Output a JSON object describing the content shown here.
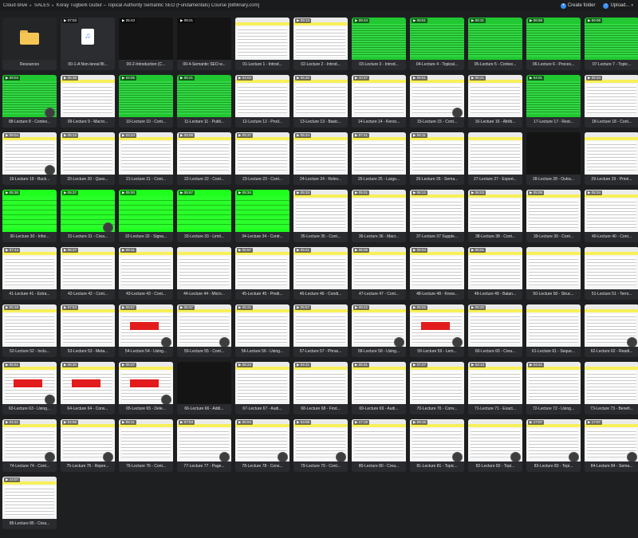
{
  "breadcrumb": {
    "items": [
      "Cloud drive",
      "SALES",
      "Koray Tugberk Gubur – Topical Authority Semantic SEO (Fundamentals) Course [bitfilinary.com]"
    ]
  },
  "actions": {
    "create_folder": "Create folder",
    "upload": "Upload..."
  },
  "tiles": [
    {
      "label": "Resources",
      "kind": "folder",
      "dur": ""
    },
    {
      "label": "00-1-A Non-Isreal Bl...",
      "kind": "audio",
      "dur": "07:03"
    },
    {
      "label": "00-2-Introduction (C...",
      "kind": "dark",
      "dur": "25:43"
    },
    {
      "label": "00-4-Semantic SEO w...",
      "kind": "dark",
      "dur": "08:21"
    },
    {
      "label": "01-Lecture 1 - Introd...",
      "kind": "doc",
      "dur": ""
    },
    {
      "label": "02-Lecture 2 - Introd...",
      "kind": "doc",
      "dur": "09:13"
    },
    {
      "label": "03-Lecture 3 - Introd...",
      "kind": "green",
      "dur": "08:43"
    },
    {
      "label": "04-Lecture 4 - Topical...",
      "kind": "green",
      "dur": "08:51"
    },
    {
      "label": "05-Lecture 5 - Contex...",
      "kind": "green",
      "dur": "05:31"
    },
    {
      "label": "06-Lecture 6 - Proces...",
      "kind": "green",
      "dur": "06:55"
    },
    {
      "label": "07-Lecture 7 - Topic...",
      "kind": "green",
      "dur": "06:06"
    },
    {
      "label": "08-Lecture 8 - Contex...",
      "kind": "green",
      "dur": "09:04",
      "avatar": true
    },
    {
      "label": "09-Lecture 9 - Macro...",
      "kind": "doc",
      "dur": "05:38"
    },
    {
      "label": "10-Lecture 10 - Cont...",
      "kind": "green",
      "dur": "04:06"
    },
    {
      "label": "11-Lecture 11 - Publi...",
      "kind": "green",
      "dur": "06:21"
    },
    {
      "label": "12-Lecture 12 - Prod...",
      "kind": "doc",
      "dur": "04:04"
    },
    {
      "label": "13-Lecture 13 - Basic...",
      "kind": "doc",
      "dur": "06:20"
    },
    {
      "label": "14-Lecture 14 - Kerso...",
      "kind": "doc",
      "dur": "10:37"
    },
    {
      "label": "15-Lecture 15 - Cont...",
      "kind": "doc",
      "dur": "06:51",
      "avatar": true
    },
    {
      "label": "16-Lecture 16 - Attrib...",
      "kind": "doc",
      "dur": "05:21"
    },
    {
      "label": "17-Lecture 17 - Rest...",
      "kind": "green",
      "dur": "04:01"
    },
    {
      "label": "18-Lecture 18 - Cont...",
      "kind": "doc",
      "dur": "05:34"
    },
    {
      "label": "19-Lecture 19 - Buck...",
      "kind": "doc",
      "dur": "09:04",
      "avatar": true
    },
    {
      "label": "20-Lecture 20 - Ques...",
      "kind": "doc",
      "dur": "05:13"
    },
    {
      "label": "21-Lecture 21 - Cont...",
      "kind": "doc",
      "dur": "04:24"
    },
    {
      "label": "22-Lecture 22 - Cont...",
      "kind": "doc",
      "dur": "09:08"
    },
    {
      "label": "23-Lecture 23 - Cont...",
      "kind": "doc",
      "dur": "05:37"
    },
    {
      "label": "24-Lecture 24 - Relev...",
      "kind": "doc",
      "dur": "05:24"
    },
    {
      "label": "25-Lecture 25 - Largo...",
      "kind": "doc",
      "dur": "07:41"
    },
    {
      "label": "26-Lecture 26 - Sema...",
      "kind": "doc",
      "dur": "06:11"
    },
    {
      "label": "27-Lecture 27 - Expert...",
      "kind": "doc",
      "dur": ""
    },
    {
      "label": "28-Lecture 28 - Outra...",
      "kind": "dark",
      "dur": ""
    },
    {
      "label": "29-Lecture 29 - Priori...",
      "kind": "doc",
      "dur": ""
    },
    {
      "label": "30-Lecture 30 - Infor...",
      "kind": "bright",
      "dur": "05:30"
    },
    {
      "label": "31-Lecture 31 - Crea...",
      "kind": "bright",
      "dur": "05:37",
      "avatar": true
    },
    {
      "label": "32-Lecture 32 - Signa...",
      "kind": "bright",
      "dur": "05:00"
    },
    {
      "label": "33-Lecture 33 - Limit...",
      "kind": "bright",
      "dur": "05:57"
    },
    {
      "label": "34-Lecture 34 - Contr...",
      "kind": "bright",
      "dur": "05:34"
    },
    {
      "label": "35-Lecture 35 - Cont...",
      "kind": "doc",
      "dur": "05:33"
    },
    {
      "label": "36-Lecture 36 - Macr...",
      "kind": "doc",
      "dur": "05:01"
    },
    {
      "label": "37-Lecture 37 Supple...",
      "kind": "doc",
      "dur": "06:12"
    },
    {
      "label": "38-Lecture 38 - Cont...",
      "kind": "doc",
      "dur": "06:03"
    },
    {
      "label": "39-Lecture 39 - Cont...",
      "kind": "doc",
      "dur": "05:08"
    },
    {
      "label": "40-Lecture 40 - Cont...",
      "kind": "doc",
      "dur": "05:34"
    },
    {
      "label": "41-Lecture 41 - Extra...",
      "kind": "doc",
      "dur": "07:44"
    },
    {
      "label": "42-Lecture 42 - Cont...",
      "kind": "doc",
      "dur": "06:37"
    },
    {
      "label": "43-Lecture 43 - Cont...",
      "kind": "doc",
      "dur": "05:11"
    },
    {
      "label": "44-Lecture 44 - Micro...",
      "kind": "doc",
      "dur": ""
    },
    {
      "label": "45-Lecture 45 - Predi...",
      "kind": "doc",
      "dur": "05:57"
    },
    {
      "label": "46-Lecture 46 - Condi...",
      "kind": "doc",
      "dur": "05:21"
    },
    {
      "label": "47-Lecture 47 - Cont...",
      "kind": "doc",
      "dur": "06:06"
    },
    {
      "label": "48-Lecture 48 - Know...",
      "kind": "doc",
      "dur": "06:04"
    },
    {
      "label": "49-Lecture 49 - Balan...",
      "kind": "doc",
      "dur": "05:01"
    },
    {
      "label": "50-Lecture 50 - Struc...",
      "kind": "doc",
      "dur": ""
    },
    {
      "label": "51-Lecture 51 - Terni...",
      "kind": "doc",
      "dur": ""
    },
    {
      "label": "52-Lecture 52 - Inclu...",
      "kind": "doc",
      "dur": "05:38"
    },
    {
      "label": "53-Lecture 53 - Meta...",
      "kind": "doc",
      "dur": "07:53"
    },
    {
      "label": "54-Lecture 54 - Using...",
      "kind": "red",
      "dur": "05:57",
      "avatar": true
    },
    {
      "label": "55-Lecture 55 - Cont...",
      "kind": "doc",
      "dur": "05:37",
      "avatar": true
    },
    {
      "label": "56-Lecture 56 - Using...",
      "kind": "doc",
      "dur": "05:21"
    },
    {
      "label": "57-Lecture 57 - Phras...",
      "kind": "doc",
      "dur": "05:57"
    },
    {
      "label": "58-Lecture 58 - Using...",
      "kind": "doc",
      "dur": "09:42",
      "avatar": true
    },
    {
      "label": "59-Lecture 59 - Lem...",
      "kind": "red",
      "dur": "06:02",
      "avatar": true
    },
    {
      "label": "60-Lecture 60 - Crea...",
      "kind": "doc",
      "dur": "06:20"
    },
    {
      "label": "61-Lecture 61 - Seque...",
      "kind": "doc",
      "dur": ""
    },
    {
      "label": "62-Lecture 62 - Readi...",
      "kind": "doc",
      "dur": "",
      "avatar": true
    },
    {
      "label": "63-Lecture 63 - Using...",
      "kind": "red",
      "dur": "05:51",
      "avatar": true
    },
    {
      "label": "64-Lecture 64 - Cons...",
      "kind": "red",
      "dur": "05:30"
    },
    {
      "label": "65-Lecture 65 - Dele...",
      "kind": "red",
      "dur": "05:37",
      "avatar": true
    },
    {
      "label": "66-Lecture 66 - Addi...",
      "kind": "dark",
      "dur": ""
    },
    {
      "label": "67-Lecture 67 - Audi...",
      "kind": "doc",
      "dur": "05:23"
    },
    {
      "label": "68-Lecture 68 - First...",
      "kind": "doc",
      "dur": "04:21"
    },
    {
      "label": "69-Lecture 69 - Audi...",
      "kind": "doc",
      "dur": "05:01"
    },
    {
      "label": "70-Lecture 70 - Conv...",
      "kind": "doc",
      "dur": "07:27"
    },
    {
      "label": "71-Lecture 71 - Exact...",
      "kind": "doc",
      "dur": "04:13"
    },
    {
      "label": "72-Lecture 72 - Using...",
      "kind": "doc",
      "dur": "04:41"
    },
    {
      "label": "73-Lecture 73 - Benefi...",
      "kind": "doc",
      "dur": ""
    },
    {
      "label": "74-Lecture 74 - Cont...",
      "kind": "doc",
      "dur": "04:21",
      "avatar": true
    },
    {
      "label": "75-Lecture 75 - Repre...",
      "kind": "doc",
      "dur": "04:55",
      "avatar": true
    },
    {
      "label": "76-Lecture 76 - Cont...",
      "kind": "doc",
      "dur": "05:11"
    },
    {
      "label": "77-Lecture 77 - Page...",
      "kind": "doc",
      "dur": "07:53",
      "avatar": true
    },
    {
      "label": "78-Lecture 78 - Cons...",
      "kind": "doc",
      "dur": "05:04",
      "avatar": true
    },
    {
      "label": "79-Lecture 79 - Cont...",
      "kind": "doc",
      "dur": "03:08",
      "avatar": true
    },
    {
      "label": "80-Lecture 80 - Crea...",
      "kind": "doc",
      "dur": "17:19"
    },
    {
      "label": "81-Lecture 81 - Topic...",
      "kind": "doc",
      "dur": "09:16",
      "avatar": true
    },
    {
      "label": "82-Lecture 82 - Topi...",
      "kind": "doc",
      "dur": "",
      "avatar": true
    },
    {
      "label": "83-Lecture 83 - Topi...",
      "kind": "doc",
      "dur": "17:07",
      "avatar": true
    },
    {
      "label": "84-Lecture 84 - Sema...",
      "kind": "doc",
      "dur": "17:07",
      "avatar": true
    },
    {
      "label": "85-Lecture 85 - Crea...",
      "kind": "doc",
      "dur": "14:07"
    }
  ]
}
